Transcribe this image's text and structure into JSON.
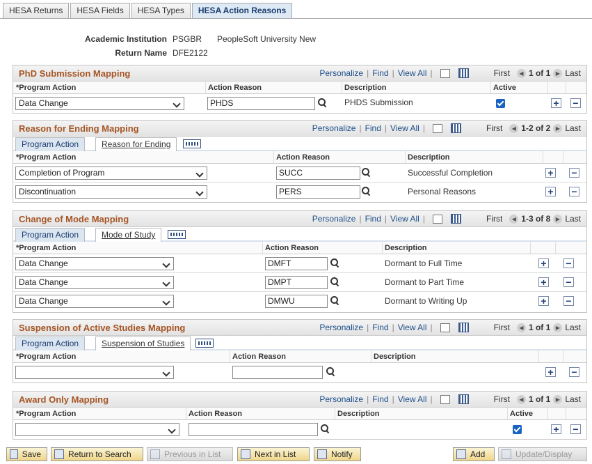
{
  "tabs": [
    "HESA Returns",
    "HESA Fields",
    "HESA Types",
    "HESA Action Reasons"
  ],
  "header": {
    "institution_label": "Academic Institution",
    "institution_code": "PSGBR",
    "institution_name": "PeopleSoft University New",
    "return_label": "Return Name",
    "return_value": "DFE2122"
  },
  "nav": {
    "personalize": "Personalize",
    "find": "Find",
    "view_all": "View All",
    "first": "First",
    "last": "Last"
  },
  "cols": {
    "program_action": "*Program Action",
    "action_reason": "Action Reason",
    "description": "Description",
    "active": "Active"
  },
  "phd": {
    "title": "PhD Submission Mapping",
    "count": "1 of 1",
    "rows": [
      {
        "program_action": "Data Change",
        "action_reason": "PHDS",
        "description": "PHDS Submission",
        "active": true
      }
    ]
  },
  "ending": {
    "title": "Reason for Ending Mapping",
    "count": "1-2 of 2",
    "tab1": "Program Action",
    "tab2": "Reason for Ending",
    "rows": [
      {
        "program_action": "Completion of Program",
        "action_reason": "SUCC",
        "description": "Successful Completion"
      },
      {
        "program_action": "Discontinuation",
        "action_reason": "PERS",
        "description": "Personal Reasons"
      }
    ]
  },
  "mode": {
    "title": "Change of Mode Mapping",
    "count": "1-3 of 8",
    "tab1": "Program Action",
    "tab2": "Mode of Study",
    "rows": [
      {
        "program_action": "Data Change",
        "action_reason": "DMFT",
        "description": "Dormant to Full Time"
      },
      {
        "program_action": "Data Change",
        "action_reason": "DMPT",
        "description": "Dormant to Part Time"
      },
      {
        "program_action": "Data Change",
        "action_reason": "DMWU",
        "description": "Dormant to Writing Up"
      }
    ]
  },
  "suspension": {
    "title": "Suspension of Active Studies Mapping",
    "count": "1 of 1",
    "tab1": "Program Action",
    "tab2": "Suspension of Studies",
    "rows": [
      {
        "program_action": "",
        "action_reason": "",
        "description": ""
      }
    ]
  },
  "award": {
    "title": "Award Only Mapping",
    "count": "1 of 1",
    "rows": [
      {
        "program_action": "",
        "action_reason": "",
        "description": "",
        "active": true
      }
    ]
  },
  "buttons": {
    "save": "Save",
    "return": "Return to Search",
    "previous": "Previous in List",
    "next": "Next in List",
    "notify": "Notify",
    "add": "Add",
    "update": "Update/Display"
  }
}
